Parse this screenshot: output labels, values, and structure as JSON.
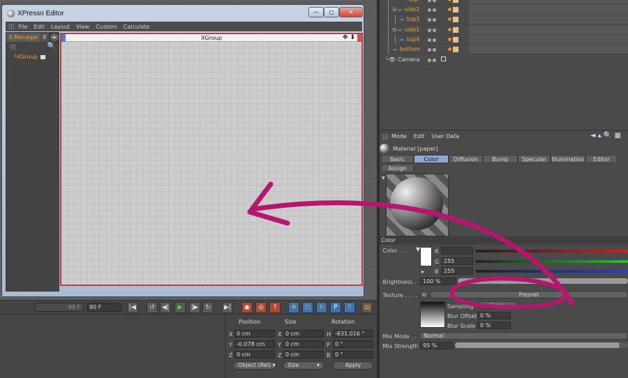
{
  "xpresso": {
    "title": "XPresso Editor",
    "menu": [
      "File",
      "Edit",
      "Layout",
      "View",
      "Custom",
      "Calculate"
    ],
    "tab_manager": "X-Manager",
    "tab_other": "X",
    "tree_item": "XGroup",
    "canvas_title": "XGroup",
    "btn_min": "—",
    "btn_max": "◻",
    "btn_close": "✕"
  },
  "objects": [
    {
      "name": "top",
      "color": "orange"
    },
    {
      "name": "side2",
      "color": "orange"
    },
    {
      "name": "top3",
      "color": "orange"
    },
    {
      "name": "side1",
      "color": "orange"
    },
    {
      "name": "top4",
      "color": "orange"
    },
    {
      "name": "bottom",
      "color": "orange"
    },
    {
      "name": "Camera",
      "color": "white"
    }
  ],
  "attributes": {
    "menu": [
      "Mode",
      "Edit",
      "User Data"
    ],
    "material_title": "Material [paper]",
    "tabs": [
      "Basic",
      "Color",
      "Diffusion",
      "Bump",
      "Specular",
      "Illumination",
      "Editor",
      "Assign"
    ],
    "active_tab": "Color",
    "section": "Color",
    "color_label": "Color . . . .",
    "r_label": "R",
    "g_label": "G",
    "b_label": "B",
    "r_value": "",
    "g_value": "255",
    "b_value": "255",
    "brightness_label": "Brightness .",
    "brightness_value": "100 %",
    "texture_label": "Texture . . . .",
    "texture_value": "Fresnel",
    "sampling_label": "Sampling",
    "sampling_value": "None",
    "blur_offset_label": "Blur Offset",
    "blur_offset_value": "0 %",
    "blur_scale_label": "Blur Scale",
    "blur_scale_value": "0 %",
    "mix_mode_label": "Mix Mode . .",
    "mix_mode_value": "Normal",
    "mix_strength_label": "Mix Strength",
    "mix_strength_value": "95 %"
  },
  "timeline": {
    "end_frame": "90 F",
    "frame_field": "90 F"
  },
  "coordinates": {
    "headers": [
      "Position",
      "Size",
      "Rotation"
    ],
    "rows": [
      {
        "pos_axis": "X",
        "pos": "0 cm",
        "size_axis": "X",
        "size": "0 cm",
        "rot_axis": "H",
        "rot": "-631.016 °"
      },
      {
        "pos_axis": "Y",
        "pos": "-0.078 cm",
        "size_axis": "Y",
        "size": "0 cm",
        "rot_axis": "P",
        "rot": "0 °"
      },
      {
        "pos_axis": "Z",
        "pos": "0 cm",
        "size_axis": "Z",
        "size": "0 cm",
        "rot_axis": "B",
        "rot": "0 °"
      }
    ],
    "mode_select": "Object (Rel)",
    "size_select": "Size",
    "apply": "Apply"
  },
  "annotation": {
    "color": "#b5176f"
  }
}
